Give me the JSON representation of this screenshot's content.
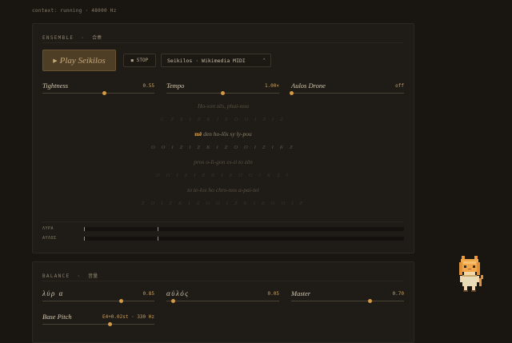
{
  "status": "context: running · 48000 Hz",
  "ensemble": {
    "title": "ENSEMBLE",
    "title_cjk": "合奏",
    "play_label": "Play Seikilos",
    "stop_label": "STOP",
    "piece_select": "Seikilos · Wikimedia MIDI",
    "controls": [
      {
        "label": "Tightness",
        "value": "0.55",
        "level": 0.55
      },
      {
        "label": "Tempo",
        "value": "1.00×",
        "level": 0.5
      },
      {
        "label": "Aulos Drone",
        "value": "off",
        "level": 0.0
      }
    ],
    "lyrics": [
      {
        "text": "Ho-son zês, phai-nou",
        "notes": "",
        "active": false
      },
      {
        "text": "",
        "notes": "C Z Z Ι Ζ Κ Ι Ζ Ō Ο Ι Ζ Ι Ζ",
        "active": false
      },
      {
        "highlight": "mē",
        "text": " den ho-lōs sy ly-pou",
        "notes": "",
        "active": true
      },
      {
        "text": "",
        "notes": "Ο Ο Ι Ζ Ι Ζ Κ Ι Ζ Ο Ο Ι Ζ Ι Κ Ζ",
        "active": true
      },
      {
        "text": "pros o-li-gon es-ti to zên",
        "notes": "",
        "active": false
      },
      {
        "text": "",
        "notes": "Ο Ο Ι Ζ Ι Ζ Κ Ι Ζ Ο Ο Ι Κ Ζ Ι",
        "active": false
      },
      {
        "text": "to te-los ho chro-nos a-pai-tei",
        "notes": "",
        "active": false
      },
      {
        "text": "",
        "notes": "Ζ Ο Ι Ζ Κ Ι Ζ Ο Ο Ι Ζ Κ Ι Ζ Ο Ο Ι Ζ",
        "active": false
      }
    ],
    "meters": [
      {
        "label": "ΛΥΡΑ",
        "marks": [
          0.0,
          0.23
        ]
      },
      {
        "label": "ΑΥΛΟΣ",
        "marks": [
          0.0,
          0.23
        ]
      }
    ]
  },
  "balance": {
    "title": "BALANCE",
    "title_cjk": "音量",
    "controls": [
      {
        "label": "λύρ α",
        "value": "0.85",
        "level": 0.7,
        "greek": true
      },
      {
        "label": "αὐλός",
        "value": "0.05",
        "level": 0.06,
        "greek": true
      },
      {
        "label": "Master",
        "value": "0.70",
        "level": 0.7,
        "greek": false
      }
    ],
    "pitch": {
      "label": "Base Pitch",
      "value": "E4+0.02st · 330 Hz",
      "level": 0.6
    }
  },
  "colors": {
    "accent": "#d59a48",
    "background": "#191612",
    "panel": "#1f1b16"
  }
}
